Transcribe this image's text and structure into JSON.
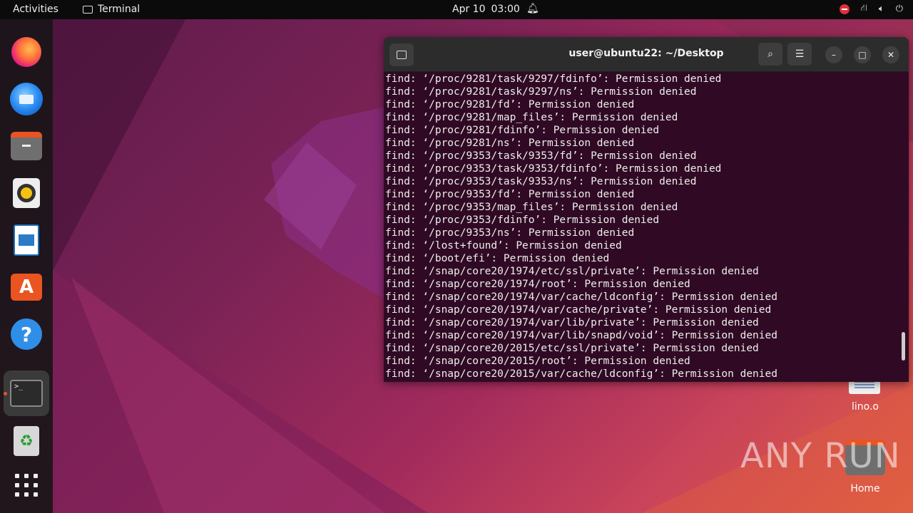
{
  "topbar": {
    "activities": "Activities",
    "app_name": "Terminal",
    "date": "Apr 10",
    "time": "03:00"
  },
  "dock": {
    "items": [
      "firefox",
      "thunderbird",
      "files",
      "rhythmbox",
      "libreoffice-writer",
      "app-center",
      "help",
      "terminal",
      "trash",
      "show-applications"
    ]
  },
  "desktop": {
    "icons": [
      {
        "label": "lino.o"
      },
      {
        "label": "Home"
      }
    ],
    "watermark": "ANY RUN"
  },
  "terminal": {
    "title": "user@ubuntu22: ~/Desktop",
    "lines": [
      "find: ‘/proc/9281/task/9297/fdinfo’: Permission denied",
      "find: ‘/proc/9281/task/9297/ns’: Permission denied",
      "find: ‘/proc/9281/fd’: Permission denied",
      "find: ‘/proc/9281/map_files’: Permission denied",
      "find: ‘/proc/9281/fdinfo’: Permission denied",
      "find: ‘/proc/9281/ns’: Permission denied",
      "find: ‘/proc/9353/task/9353/fd’: Permission denied",
      "find: ‘/proc/9353/task/9353/fdinfo’: Permission denied",
      "find: ‘/proc/9353/task/9353/ns’: Permission denied",
      "find: ‘/proc/9353/fd’: Permission denied",
      "find: ‘/proc/9353/map_files’: Permission denied",
      "find: ‘/proc/9353/fdinfo’: Permission denied",
      "find: ‘/proc/9353/ns’: Permission denied",
      "find: ‘/lost+found’: Permission denied",
      "find: ‘/boot/efi’: Permission denied",
      "find: ‘/snap/core20/1974/etc/ssl/private’: Permission denied",
      "find: ‘/snap/core20/1974/root’: Permission denied",
      "find: ‘/snap/core20/1974/var/cache/ldconfig’: Permission denied",
      "find: ‘/snap/core20/1974/var/cache/private’: Permission denied",
      "find: ‘/snap/core20/1974/var/lib/private’: Permission denied",
      "find: ‘/snap/core20/1974/var/lib/snapd/void’: Permission denied",
      "find: ‘/snap/core20/2015/etc/ssl/private’: Permission denied",
      "find: ‘/snap/core20/2015/root’: Permission denied",
      "find: ‘/snap/core20/2015/var/cache/ldconfig’: Permission denied"
    ]
  },
  "colors": {
    "terminal_bg": "#300a24",
    "titlebar_bg": "#2c2c2c",
    "accent": "#e95420"
  }
}
